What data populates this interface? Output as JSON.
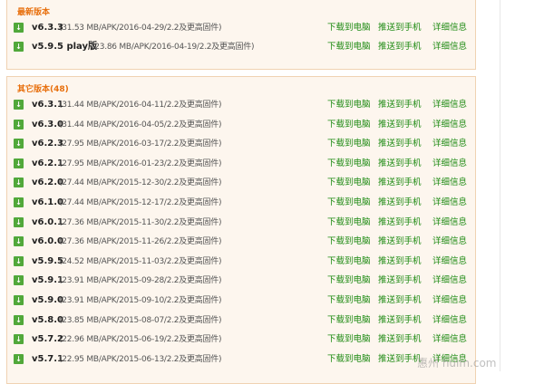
{
  "latest": {
    "title": "最新版本",
    "items": [
      {
        "version": "v6.3.3",
        "meta": "(31.53 MB/APK/2016-04-29/2.2及更高固件)"
      },
      {
        "version": "v5.9.5 play版",
        "meta": "(23.86 MB/APK/2016-04-19/2.2及更高固件)"
      }
    ]
  },
  "other": {
    "title": "其它版本(48)",
    "items": [
      {
        "version": "v6.3.1",
        "meta": "(31.44 MB/APK/2016-04-11/2.2及更高固件)"
      },
      {
        "version": "v6.3.0",
        "meta": "(31.44 MB/APK/2016-04-05/2.2及更高固件)"
      },
      {
        "version": "v6.2.3",
        "meta": "(27.95 MB/APK/2016-03-17/2.2及更高固件)"
      },
      {
        "version": "v6.2.1",
        "meta": "(27.95 MB/APK/2016-01-23/2.2及更高固件)"
      },
      {
        "version": "v6.2.0",
        "meta": "(27.44 MB/APK/2015-12-30/2.2及更高固件)"
      },
      {
        "version": "v6.1.0",
        "meta": "(27.44 MB/APK/2015-12-17/2.2及更高固件)"
      },
      {
        "version": "v6.0.1",
        "meta": "(27.36 MB/APK/2015-11-30/2.2及更高固件)"
      },
      {
        "version": "v6.0.0",
        "meta": "(27.36 MB/APK/2015-11-26/2.2及更高固件)"
      },
      {
        "version": "v5.9.5",
        "meta": "(24.52 MB/APK/2015-11-03/2.2及更高固件)"
      },
      {
        "version": "v5.9.1",
        "meta": "(23.91 MB/APK/2015-09-28/2.2及更高固件)"
      },
      {
        "version": "v5.9.0",
        "meta": "(23.91 MB/APK/2015-09-10/2.2及更高固件)"
      },
      {
        "version": "v5.8.0",
        "meta": "(23.85 MB/APK/2015-08-07/2.2及更高固件)"
      },
      {
        "version": "v5.7.2",
        "meta": "(22.96 MB/APK/2015-06-19/2.2及更高固件)"
      },
      {
        "version": "v5.7.1",
        "meta": "(22.95 MB/APK/2015-06-13/2.2及更高固件)"
      }
    ]
  },
  "actions": {
    "download_pc": "下载到电脑",
    "push_phone": "推送到手机",
    "details": "详细信息"
  },
  "icons": {
    "download": "download-icon"
  },
  "watermark": "惠州 huim.com",
  "colors": {
    "accent": "#e8700e",
    "link": "#1d8a12",
    "icon": "#51a83a",
    "panel_bg": "#fdf6ee",
    "panel_border": "#f0d2b2"
  }
}
